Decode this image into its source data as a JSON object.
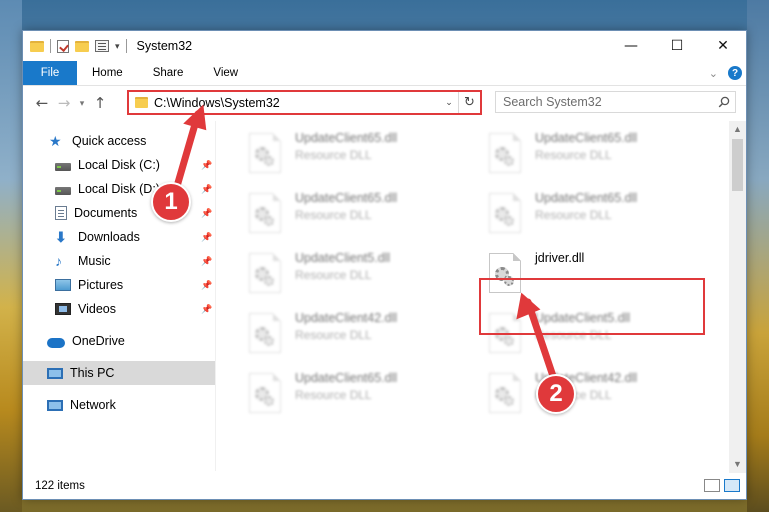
{
  "window": {
    "title": "System32",
    "controls": {
      "minimize": "—",
      "maximize": "☐",
      "close": "✕"
    }
  },
  "ribbon": {
    "tabs": [
      "File",
      "Home",
      "Share",
      "View"
    ],
    "expand_icon": "chevron-down-icon",
    "help_label": "?"
  },
  "address": {
    "path": "C:\\Windows\\System32",
    "refresh_icon": "refresh-icon"
  },
  "search": {
    "placeholder": "Search System32"
  },
  "navpane": {
    "items": [
      {
        "label": "Quick access",
        "icon": "star-icon"
      },
      {
        "label": "Local Disk (C:)",
        "icon": "disk-icon",
        "pinned": true
      },
      {
        "label": "Local Disk (D:)",
        "icon": "disk-icon",
        "pinned": true
      },
      {
        "label": "Documents",
        "icon": "documents-icon",
        "pinned": true
      },
      {
        "label": "Downloads",
        "icon": "downloads-icon",
        "pinned": true
      },
      {
        "label": "Music",
        "icon": "music-icon",
        "pinned": true
      },
      {
        "label": "Pictures",
        "icon": "pictures-icon",
        "pinned": true
      },
      {
        "label": "Videos",
        "icon": "videos-icon",
        "pinned": true
      },
      {
        "label": "OneDrive",
        "icon": "cloud-icon"
      },
      {
        "label": "This PC",
        "icon": "computer-icon"
      },
      {
        "label": "Network",
        "icon": "network-icon"
      }
    ]
  },
  "files": [
    {
      "name": "UpdateClient65.dll",
      "type": "Resource DLL"
    },
    {
      "name": "UpdateClient65.dll",
      "type": "Resource DLL"
    },
    {
      "name": "UpdateClient65.dll",
      "type": "Resource DLL"
    },
    {
      "name": "UpdateClient65.dll",
      "type": "Resource DLL"
    },
    {
      "name": "UpdateClient5.dll",
      "type": "Resource DLL"
    },
    {
      "name": "jdriver.dll",
      "type": ""
    },
    {
      "name": "UpdateClient42.dll",
      "type": "Resource DLL"
    },
    {
      "name": "UpdateClient5.dll",
      "type": "Resource DLL"
    },
    {
      "name": "UpdateClient65.dll",
      "type": "Resource DLL"
    },
    {
      "name": "UpdateClient42.dll",
      "type": "Resource DLL"
    }
  ],
  "status": {
    "item_count": "122 items"
  },
  "annotations": {
    "step1": "1",
    "step2": "2",
    "color": "#e0393b"
  }
}
